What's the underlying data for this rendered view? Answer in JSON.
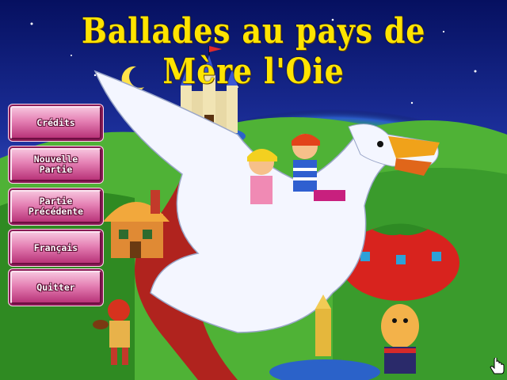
{
  "title": "Ballades au pays de Mère l'Oie",
  "menu": {
    "credits": "Crédits",
    "new_game": "Nouvelle\nPartie",
    "previous_game": "Partie\nPrécédente",
    "language": "Français",
    "quit": "Quitter"
  },
  "colors": {
    "title": "#ffe400",
    "button_face": "#e47fb3",
    "button_dark": "#b93479",
    "sky": "#0a1a6a",
    "grass": "#3d9a2a"
  },
  "icons": {
    "cursor": "hand-pointer-icon"
  }
}
